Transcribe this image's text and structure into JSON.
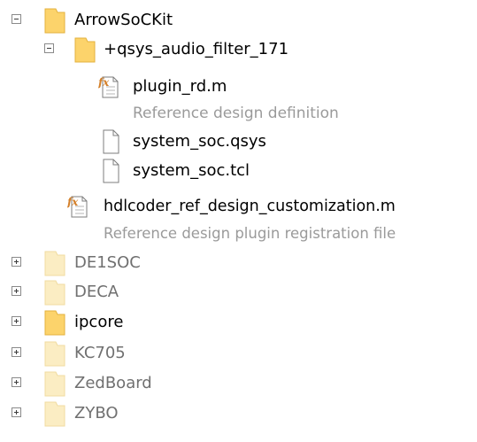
{
  "tree": {
    "root": {
      "label": "ArrowSoCKit",
      "expanded": true,
      "icon": "folder-icon",
      "children": {
        "package": {
          "prefix": "+",
          "label": "qsys_audio_filter_171",
          "expanded": true,
          "icon": "folder-icon",
          "plugin": {
            "label": "plugin_rd.m",
            "description": "Reference design definition",
            "icon": "matlab-function-icon"
          },
          "files": [
            {
              "label": "system_soc.qsys",
              "icon": "file-icon"
            },
            {
              "label": "system_soc.tcl",
              "icon": "file-icon"
            }
          ]
        },
        "customization": {
          "label": "hdlcoder_ref_design_customization.m",
          "description": "Reference design plugin registration file",
          "icon": "matlab-function-icon"
        }
      }
    },
    "siblings": [
      {
        "label": "DE1SOC",
        "expanded": false,
        "dimmed": true
      },
      {
        "label": "DECA",
        "expanded": false,
        "dimmed": true
      },
      {
        "label": "ipcore",
        "expanded": false,
        "dimmed": false
      },
      {
        "label": "KC705",
        "expanded": false,
        "dimmed": true
      },
      {
        "label": "ZedBoard",
        "expanded": false,
        "dimmed": true
      },
      {
        "label": "ZYBO",
        "expanded": false,
        "dimmed": true
      }
    ]
  },
  "colors": {
    "folder": "#fcd36b",
    "folder_dim": "#fbedc3",
    "text": "#000000",
    "text_dim": "#707070",
    "description": "#9a9a9a"
  }
}
